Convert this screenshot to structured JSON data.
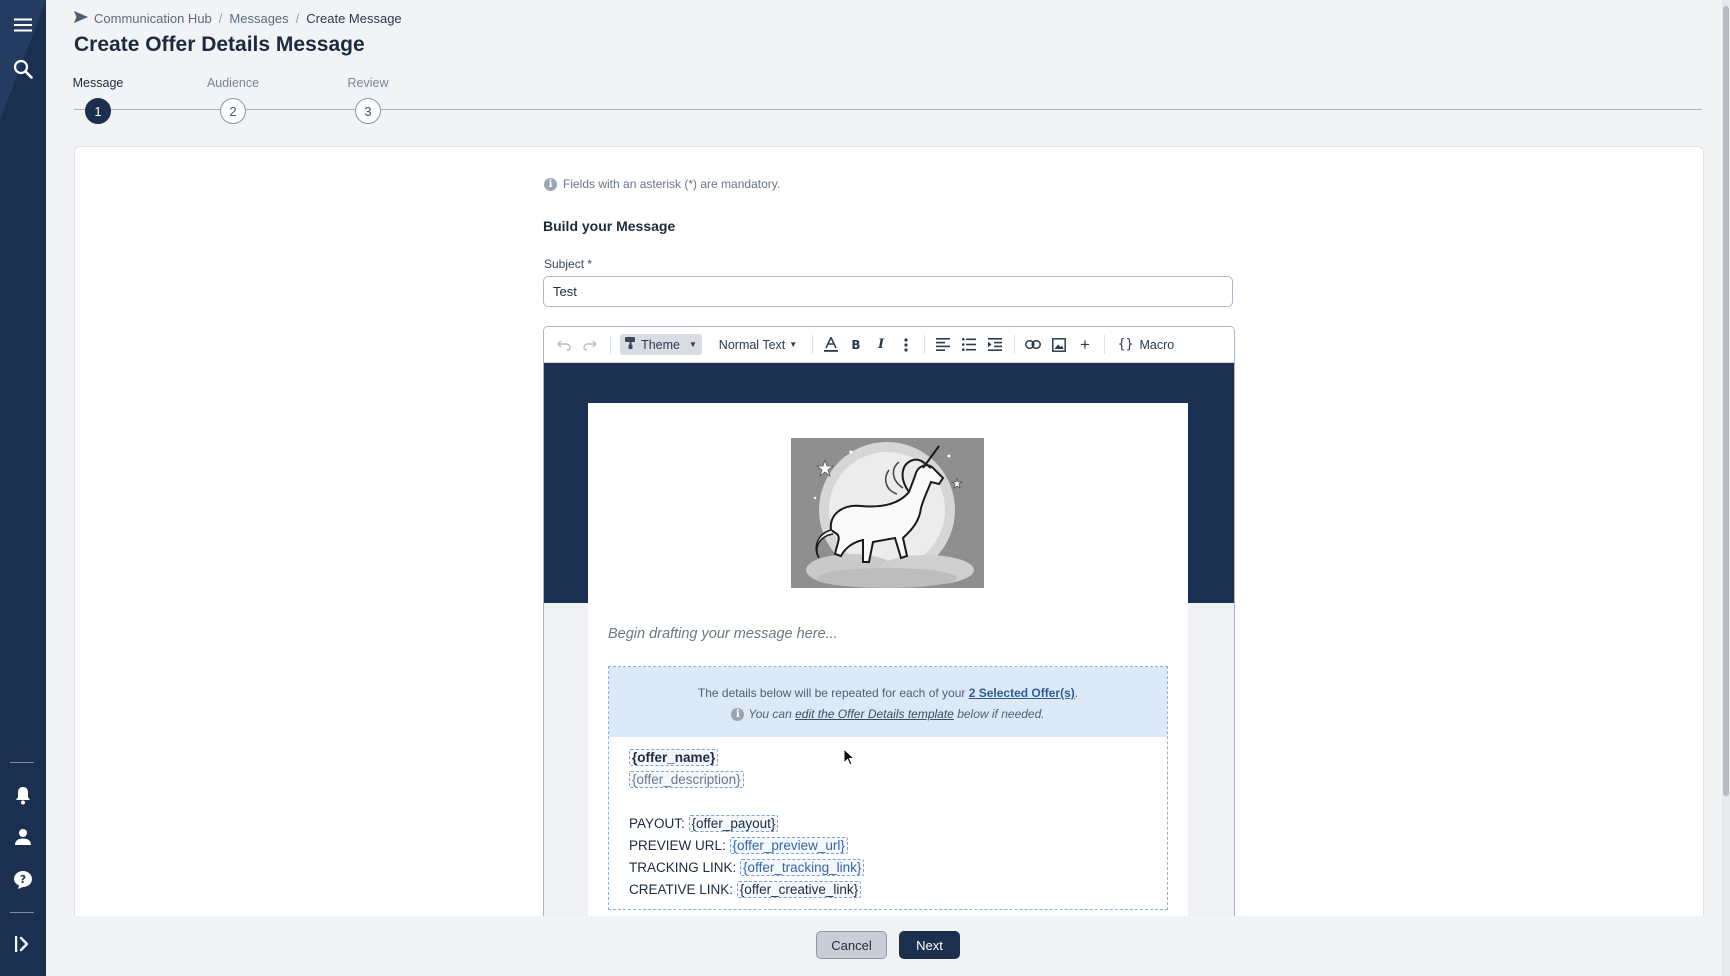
{
  "breadcrumb": {
    "items": [
      "Communication Hub",
      "Messages",
      "Create Message"
    ],
    "separator": "/"
  },
  "page_title": "Create Offer Details Message",
  "stepper": {
    "steps": [
      {
        "label": "Message",
        "number": "1",
        "active": true
      },
      {
        "label": "Audience",
        "number": "2",
        "active": false
      },
      {
        "label": "Review",
        "number": "3",
        "active": false
      }
    ]
  },
  "form": {
    "note": "Fields with an asterisk (*) are mandatory.",
    "section_title": "Build your Message",
    "subject_label": "Subject",
    "subject_required_mark": "*",
    "subject_value": "Test"
  },
  "editor": {
    "toolbar": {
      "theme_label": "Theme",
      "text_style_label": "Normal Text",
      "macro_label": "Macro"
    },
    "placeholder": "Begin drafting your message here...",
    "offer_block": {
      "banner_prefix": "The details below will be repeated for each of your ",
      "selected_offers_link": "2 Selected Offer(s)",
      "banner_suffix": ".",
      "line2_prefix": "You can ",
      "template_link": "edit the Offer Details template",
      "line2_suffix": " below if needed.",
      "offer_name": "{offer_name}",
      "offer_description": "{offer_description}",
      "payout_label": "PAYOUT:",
      "payout_macro": "{offer_payout}",
      "preview_label": "PREVIEW URL:",
      "preview_macro": "{offer_preview_url}",
      "tracking_label": "TRACKING LINK:",
      "tracking_macro": "{offer_tracking_link}",
      "creative_label": "CREATIVE LINK:",
      "creative_macro": "{offer_creative_link}"
    }
  },
  "footer": {
    "cancel_label": "Cancel",
    "next_label": "Next"
  },
  "colors": {
    "sidebar": "#1b3050",
    "primary": "#1c2f4e",
    "link": "#2d5d9b",
    "banner": "#dde9f6"
  },
  "icons": {
    "sidebar": [
      "menu-icon",
      "search-icon",
      "bell-icon",
      "user-icon",
      "help-icon",
      "expand-sidebar-icon"
    ],
    "toolbar": [
      "undo-icon",
      "redo-icon",
      "paint-brush-icon",
      "font-color-icon",
      "bold-icon",
      "italic-icon",
      "more-icon",
      "align-left-icon",
      "list-icon",
      "indent-icon",
      "link-icon",
      "image-icon",
      "plus-icon",
      "braces-icon"
    ]
  }
}
